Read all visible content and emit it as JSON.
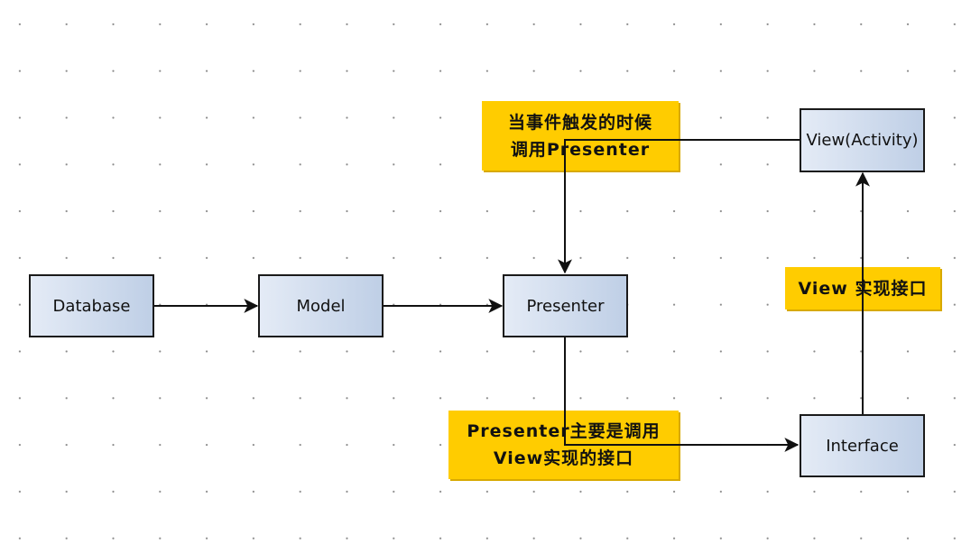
{
  "diagram": {
    "nodes": {
      "database": "Database",
      "model": "Model",
      "presenter": "Presenter",
      "view": "View(Activity)",
      "interface": "Interface"
    },
    "notes": {
      "event": [
        "当事件触发的时候",
        "调用Presenter"
      ],
      "presenter_calls": [
        "Presenter主要是调用",
        "View实现的接口"
      ],
      "view_implements": [
        "View 实现接口"
      ]
    },
    "edges": [
      {
        "from": "database",
        "to": "model"
      },
      {
        "from": "model",
        "to": "presenter"
      },
      {
        "from": "view",
        "to": "presenter"
      },
      {
        "from": "presenter",
        "to": "interface"
      },
      {
        "from": "interface",
        "to": "view"
      }
    ],
    "colors": {
      "note_fill": "#ffcc00",
      "node_fill_start": "#e4ebf6",
      "node_fill_end": "#bfcfe6",
      "stroke": "#111111"
    }
  }
}
